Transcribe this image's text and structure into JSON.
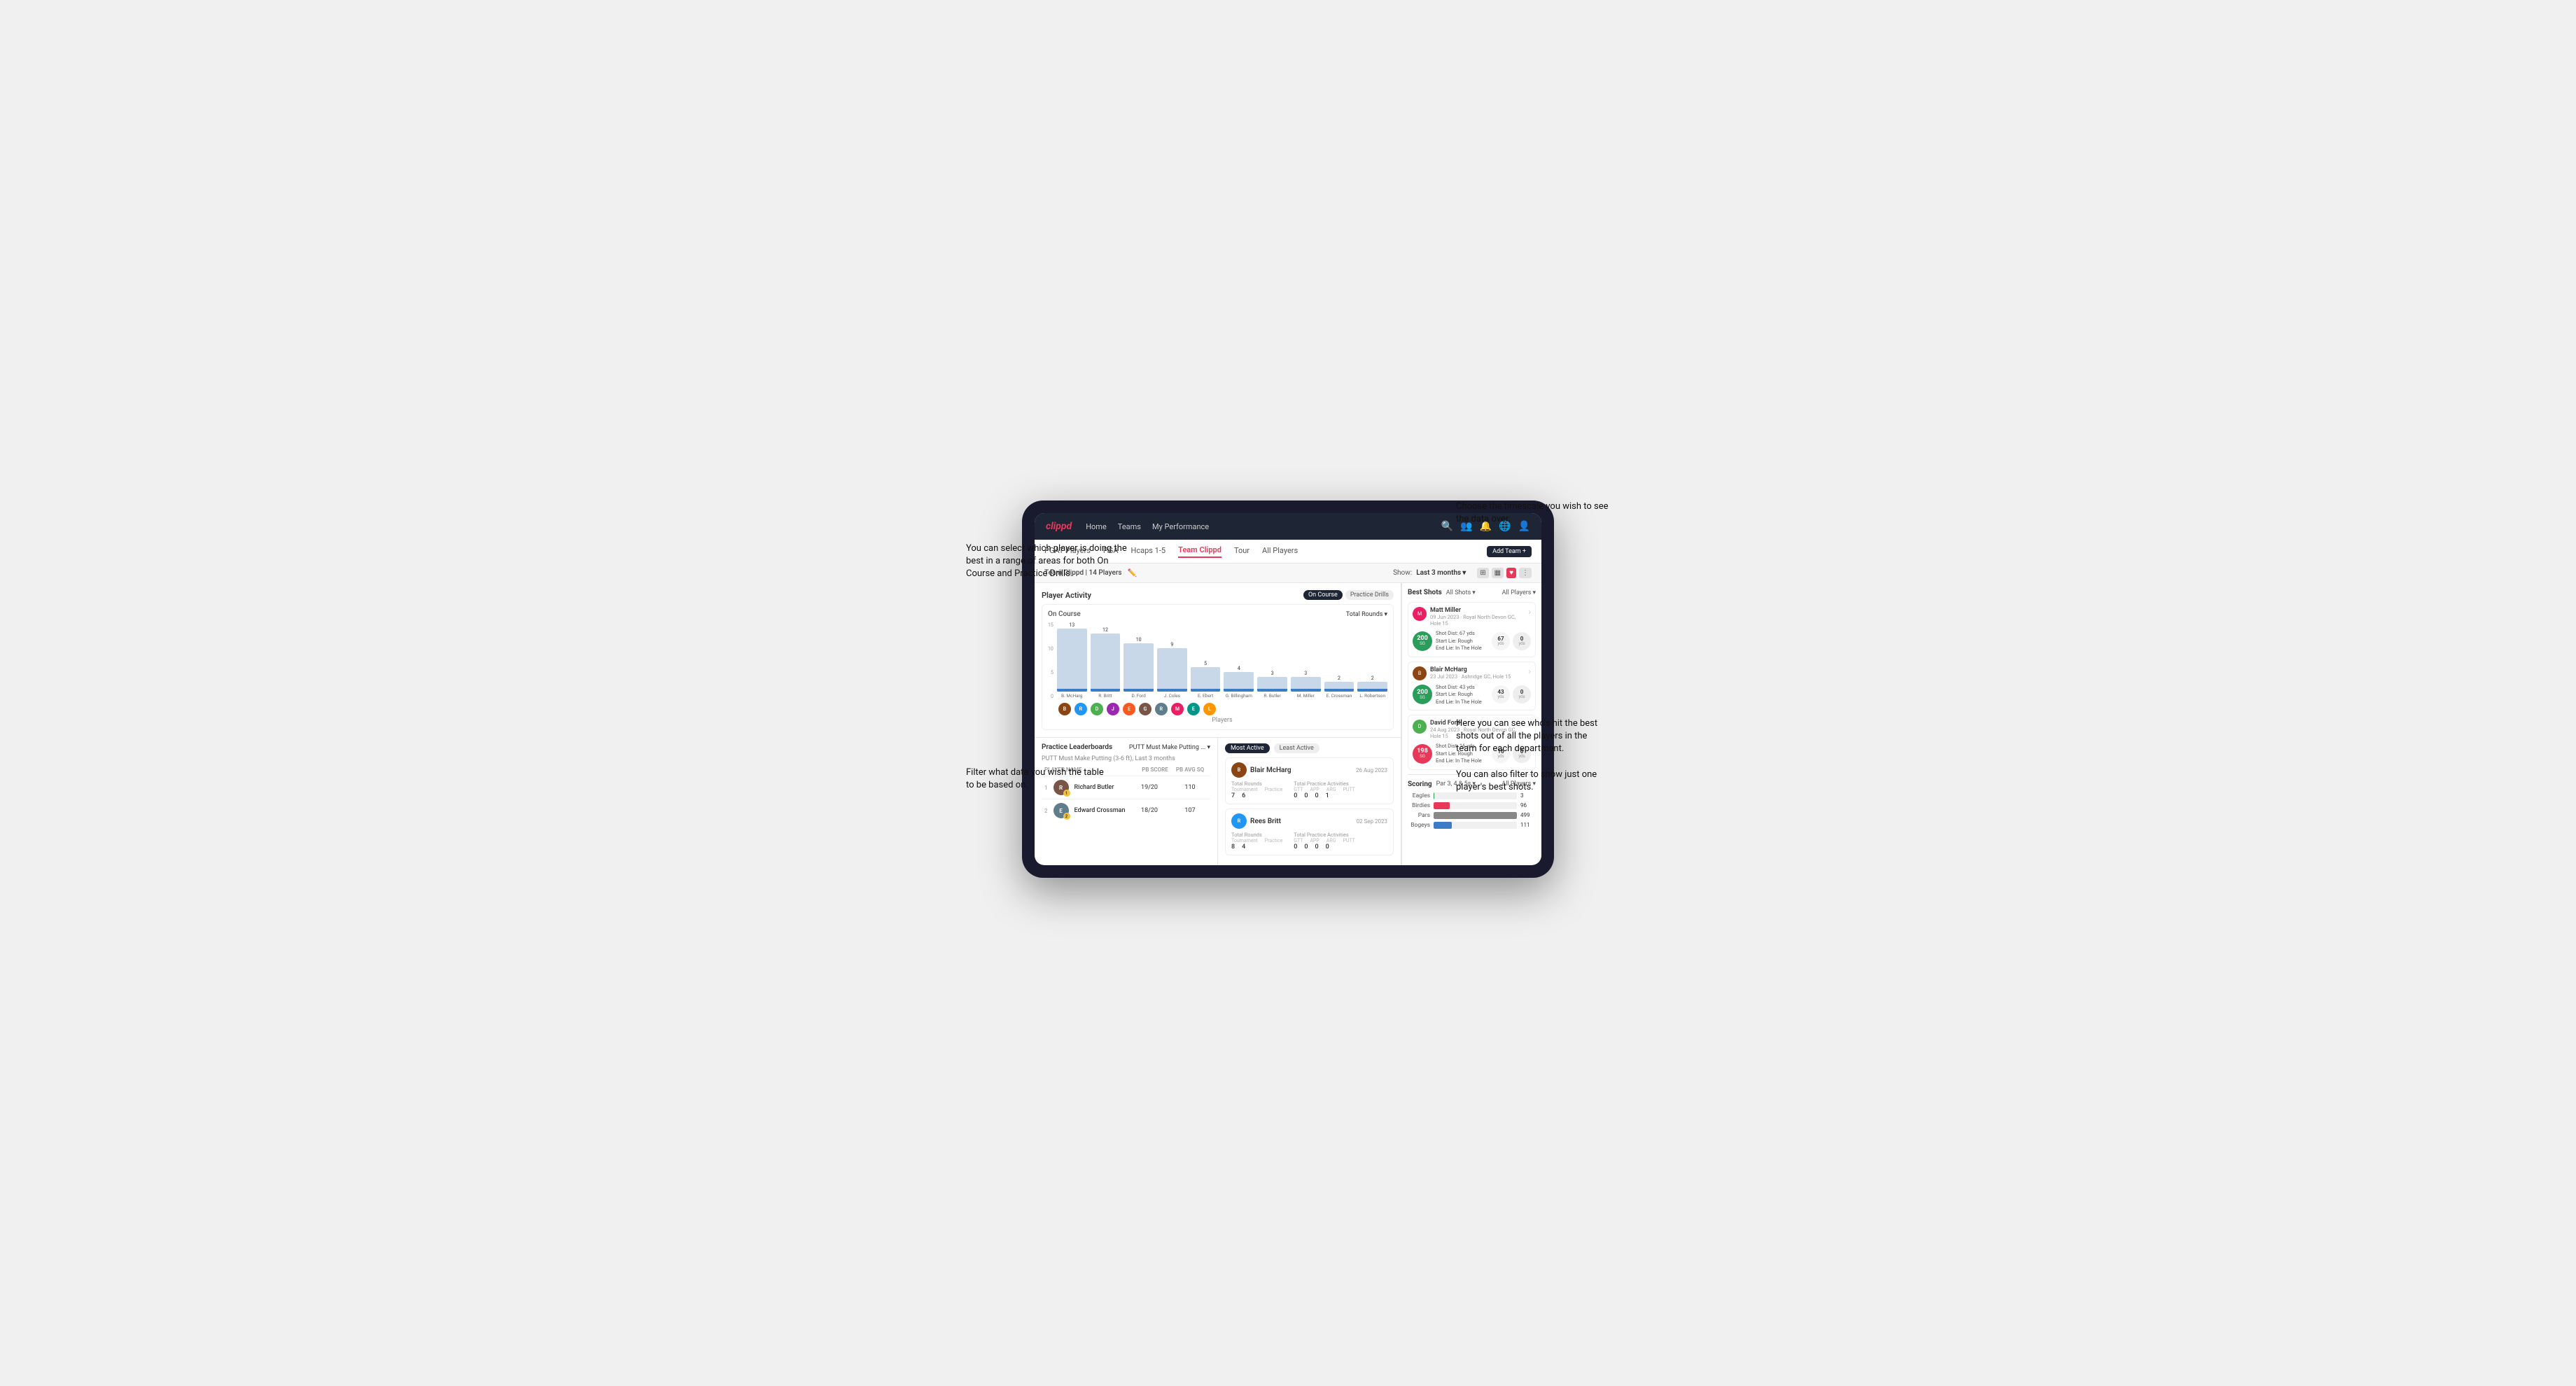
{
  "annotations": {
    "top_left": "You can select which player is doing the best in a range of areas for both On Course and Practice Drills.",
    "bottom_left": "Filter what data you wish the table to be based on.",
    "top_right": "Choose the timescale you wish to see the data over.",
    "bottom_right": "Here you can see who's hit the best shots out of all the players in the team for each department.\n\nYou can also filter to show just one player's best shots."
  },
  "nav": {
    "logo": "clippd",
    "links": [
      "Home",
      "Teams",
      "My Performance"
    ],
    "icons": [
      "search",
      "users",
      "bell",
      "globe",
      "user"
    ]
  },
  "tabs": {
    "items": [
      "PGAT Players",
      "PGA",
      "Hcaps 1-5",
      "Team Clippd",
      "Tour",
      "All Players"
    ],
    "active": "Team Clippd",
    "add_button": "Add Team +"
  },
  "filter_row": {
    "label": "Team Clippd | 14 Players",
    "show": "Show:",
    "timeframe": "Last 3 months",
    "view_icons": [
      "grid-4",
      "grid-2",
      "heart",
      "settings"
    ]
  },
  "player_activity": {
    "title": "Player Activity",
    "toggle_options": [
      "On Course",
      "Practice Drills"
    ],
    "active_toggle": "On Course",
    "chart": {
      "label": "On Course",
      "dropdown": "Total Rounds",
      "y_labels": [
        "15",
        "10",
        "5",
        "0"
      ],
      "bars": [
        {
          "name": "B. McHarg",
          "value": 13,
          "height": 90
        },
        {
          "name": "R. Britt",
          "value": 12,
          "height": 83
        },
        {
          "name": "D. Ford",
          "value": 10,
          "height": 69
        },
        {
          "name": "J. Coles",
          "value": 9,
          "height": 62
        },
        {
          "name": "E. Ebert",
          "value": 5,
          "height": 35
        },
        {
          "name": "G. Billingham",
          "value": 4,
          "height": 28
        },
        {
          "name": "R. Butler",
          "value": 3,
          "height": 21
        },
        {
          "name": "M. Miller",
          "value": 3,
          "height": 21
        },
        {
          "name": "E. Crossman",
          "value": 2,
          "height": 14
        },
        {
          "name": "L. Robertson",
          "value": 2,
          "height": 14
        }
      ],
      "x_label": "Players",
      "avatar_colors": [
        "#8B4513",
        "#2196F3",
        "#4CAF50",
        "#9C27B0",
        "#FF5722",
        "#795548",
        "#607D8B",
        "#E91E63",
        "#009688",
        "#FF9800"
      ]
    }
  },
  "practice_leaderboard": {
    "title": "Practice Leaderboards",
    "drill": "PUTT Must Make Putting ...",
    "subtitle": "PUTT Must Make Putting (3-6 ft), Last 3 months",
    "columns": {
      "name": "PLAYER NAME",
      "score": "PB SCORE",
      "avg": "PB AVG SQ"
    },
    "rows": [
      {
        "rank": 1,
        "name": "Richard Butler",
        "score": "19/20",
        "avg": "110",
        "badge_type": "gold",
        "badge_num": "1",
        "color": "#795548"
      },
      {
        "rank": 2,
        "name": "Edward Crossman",
        "score": "18/20",
        "avg": "107",
        "badge_type": "silver",
        "badge_num": "2",
        "color": "#607D8B"
      }
    ]
  },
  "most_active": {
    "title": "Most Active",
    "tab_options": [
      "Most Active",
      "Least Active"
    ],
    "active_tab": "Most Active",
    "players": [
      {
        "name": "Blair McHarg",
        "date": "26 Aug 2023",
        "avatar_color": "#8B4513",
        "total_rounds_label": "Total Rounds",
        "tournament": "7",
        "practice": "6",
        "practice_activities_label": "Total Practice Activities",
        "gtt": "0",
        "app": "0",
        "arg": "0",
        "putt": "1"
      },
      {
        "name": "Rees Britt",
        "date": "02 Sep 2023",
        "avatar_color": "#2196F3",
        "total_rounds_label": "Total Rounds",
        "tournament": "8",
        "practice": "4",
        "practice_activities_label": "Total Practice Activities",
        "gtt": "0",
        "app": "0",
        "arg": "0",
        "putt": "0"
      }
    ]
  },
  "best_shots": {
    "title": "Best Shots",
    "filter": "All Shots",
    "players_filter": "All Players",
    "shots": [
      {
        "player_name": "Matt Miller",
        "player_sub": "09 Jun 2023 · Royal North Devon GC, Hole 15",
        "avatar_color": "#E91E63",
        "badge_num": "200",
        "badge_sg": "SG",
        "badge_color": "#2a9d5a",
        "shot_dist": "Shot Dist: 67 yds",
        "start_lie": "Start Lie: Rough",
        "end_lie": "End Lie: In The Hole",
        "metric1_val": "67",
        "metric1_unit": "yds",
        "metric2_val": "0",
        "metric2_unit": "yds"
      },
      {
        "player_name": "Blair McHarg",
        "player_sub": "23 Jul 2023 · Ashridge GC, Hole 15",
        "avatar_color": "#8B4513",
        "badge_num": "200",
        "badge_sg": "SG",
        "badge_color": "#2a9d5a",
        "shot_dist": "Shot Dist: 43 yds",
        "start_lie": "Start Lie: Rough",
        "end_lie": "End Lie: In The Hole",
        "metric1_val": "43",
        "metric1_unit": "yds",
        "metric2_val": "0",
        "metric2_unit": "yds"
      },
      {
        "player_name": "David Ford",
        "player_sub": "24 Aug 2023 · Royal North Devon GC, Hole 15",
        "avatar_color": "#4CAF50",
        "badge_num": "198",
        "badge_sg": "SG",
        "badge_color": "#e8385a",
        "shot_dist": "Shot Dist: 16 yds",
        "start_lie": "Start Lie: Rough",
        "end_lie": "End Lie: In The Hole",
        "metric1_val": "16",
        "metric1_unit": "yds",
        "metric2_val": "0",
        "metric2_unit": "yds"
      }
    ]
  },
  "scoring": {
    "title": "Scoring",
    "filter": "Par 3, 4 & 5s",
    "players": "All Players",
    "bars": [
      {
        "label": "Eagles",
        "value": 3,
        "percent": 2,
        "type": "eagles"
      },
      {
        "label": "Birdies",
        "value": 96,
        "percent": 18,
        "type": "birdies"
      },
      {
        "label": "Pars",
        "value": 499,
        "percent": 90,
        "type": "pars"
      },
      {
        "label": "Bogeys",
        "value": 111,
        "percent": 20,
        "type": "bogeys"
      }
    ]
  }
}
